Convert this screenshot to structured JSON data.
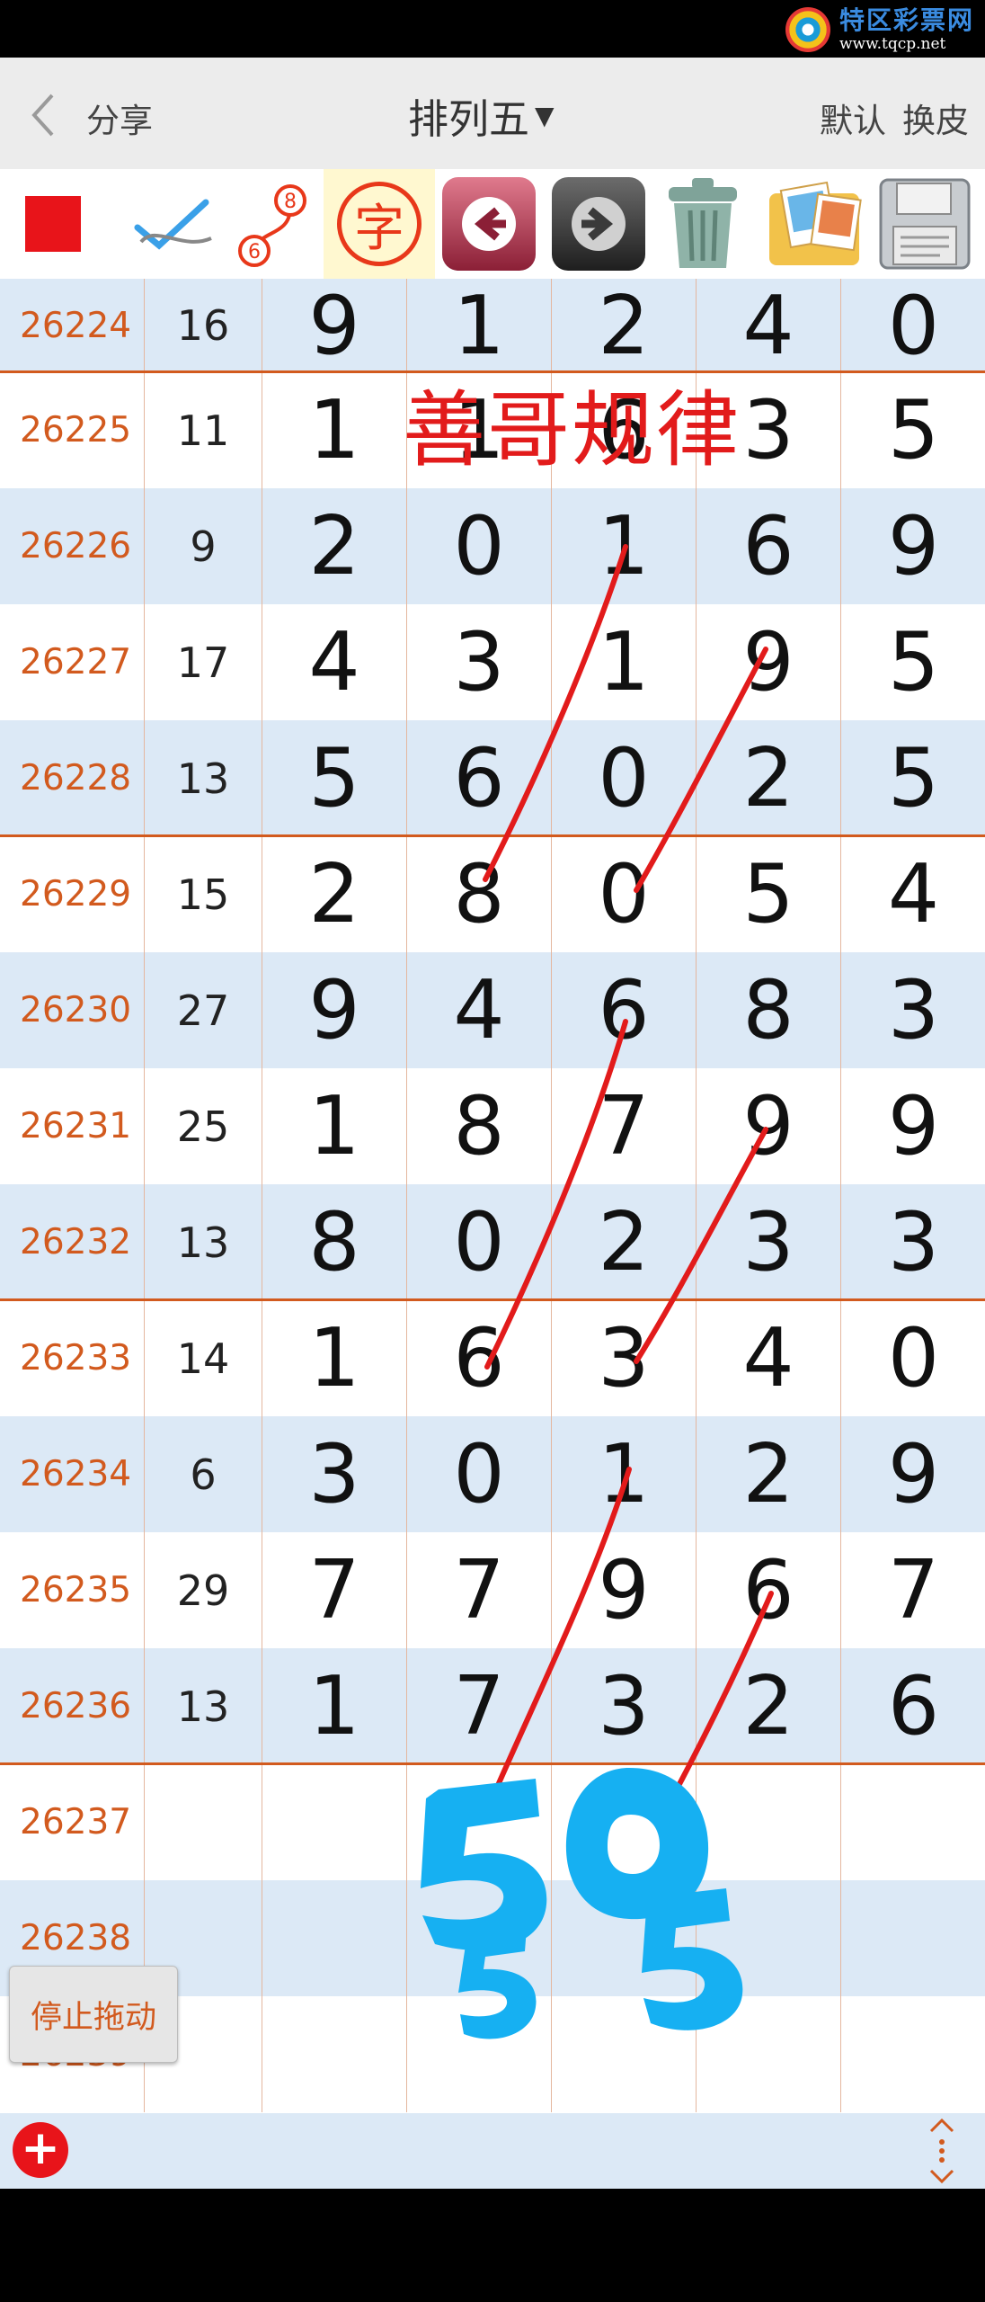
{
  "brand": {
    "name": "特区彩票网",
    "url": "www.tqcp.net"
  },
  "nav": {
    "back_label": "‹",
    "share_label": "分享",
    "title": "排列五",
    "default_label": "默认",
    "skin_label": "换皮"
  },
  "toolbar": {
    "number_top": "8",
    "number_bottom": "6",
    "zi_label": "字"
  },
  "rows": [
    {
      "issue": "26224",
      "sum": "16",
      "digits": [
        "9",
        "1",
        "2",
        "4",
        "0"
      ]
    },
    {
      "issue": "26225",
      "sum": "11",
      "digits": [
        "1",
        "1",
        "6",
        "3",
        "5"
      ]
    },
    {
      "issue": "26226",
      "sum": "9",
      "digits": [
        "2",
        "0",
        "1",
        "6",
        "9"
      ]
    },
    {
      "issue": "26227",
      "sum": "17",
      "digits": [
        "4",
        "3",
        "1",
        "9",
        "5"
      ]
    },
    {
      "issue": "26228",
      "sum": "13",
      "digits": [
        "5",
        "6",
        "0",
        "2",
        "5"
      ]
    },
    {
      "issue": "26229",
      "sum": "15",
      "digits": [
        "2",
        "8",
        "0",
        "5",
        "4"
      ]
    },
    {
      "issue": "26230",
      "sum": "27",
      "digits": [
        "9",
        "4",
        "6",
        "8",
        "3"
      ]
    },
    {
      "issue": "26231",
      "sum": "25",
      "digits": [
        "1",
        "8",
        "7",
        "9",
        "9"
      ]
    },
    {
      "issue": "26232",
      "sum": "13",
      "digits": [
        "8",
        "0",
        "2",
        "3",
        "3"
      ]
    },
    {
      "issue": "26233",
      "sum": "14",
      "digits": [
        "1",
        "6",
        "3",
        "4",
        "0"
      ]
    },
    {
      "issue": "26234",
      "sum": "6",
      "digits": [
        "3",
        "0",
        "1",
        "2",
        "9"
      ]
    },
    {
      "issue": "26235",
      "sum": "29",
      "digits": [
        "7",
        "7",
        "9",
        "6",
        "7"
      ]
    },
    {
      "issue": "26236",
      "sum": "13",
      "digits": [
        "1",
        "7",
        "3",
        "2",
        "6"
      ]
    },
    {
      "issue": "26237",
      "sum": "",
      "digits": [
        "",
        "",
        "",
        "",
        ""
      ]
    },
    {
      "issue": "26238",
      "sum": "",
      "digits": [
        "",
        "",
        "",
        "",
        ""
      ]
    },
    {
      "issue": "26239",
      "sum": "",
      "digits": [
        "",
        "",
        "",
        "",
        ""
      ]
    }
  ],
  "annotation": {
    "text": "善哥规律"
  },
  "handwritten": [
    "5",
    "0",
    "5",
    "5"
  ],
  "stop_drag_label": "停止拖动",
  "colors": {
    "issue_text": "#d25a1e",
    "row_alt": "#dce9f6",
    "annotation_red": "#e21b1b",
    "marker_blue": "#16b0f2"
  }
}
